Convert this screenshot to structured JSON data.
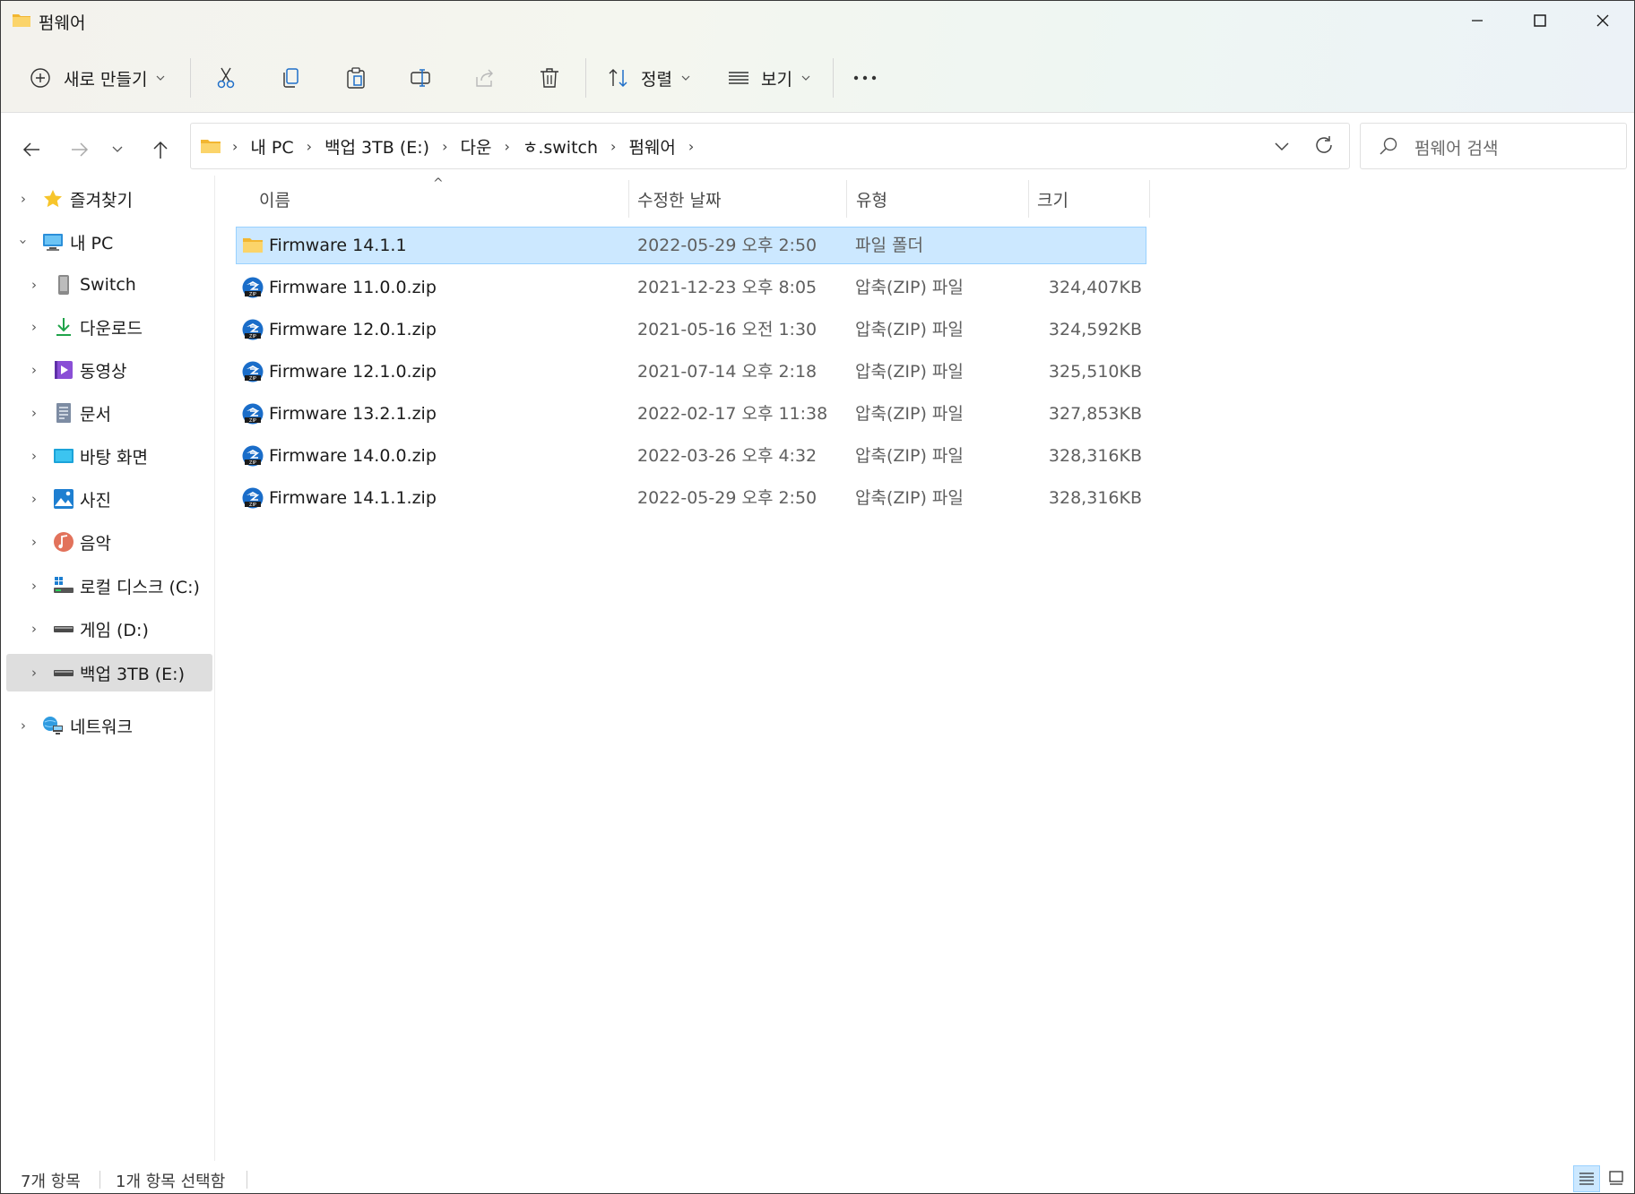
{
  "window": {
    "title": "펌웨어",
    "folder_icon": "folder-icon"
  },
  "toolbar": {
    "new_label": "새로 만들기",
    "sort_label": "정렬",
    "view_label": "보기"
  },
  "address": {
    "crumbs": [
      "내 PC",
      "백업 3TB (E:)",
      "다운",
      "ㅎ.switch",
      "펌웨어"
    ]
  },
  "search": {
    "placeholder": "펌웨어 검색"
  },
  "sidebar": {
    "items": [
      {
        "label": "즐겨찾기",
        "icon": "star-icon"
      },
      {
        "label": "내 PC",
        "icon": "pc-icon"
      },
      {
        "label": "Switch",
        "icon": "device-icon"
      },
      {
        "label": "다운로드",
        "icon": "download-icon"
      },
      {
        "label": "동영상",
        "icon": "video-icon"
      },
      {
        "label": "문서",
        "icon": "document-icon"
      },
      {
        "label": "바탕 화면",
        "icon": "desktop-icon"
      },
      {
        "label": "사진",
        "icon": "pictures-icon"
      },
      {
        "label": "음악",
        "icon": "music-icon"
      },
      {
        "label": "로컬 디스크 (C:)",
        "icon": "drive-c-icon"
      },
      {
        "label": "게임 (D:)",
        "icon": "drive-d-icon"
      },
      {
        "label": "백업 3TB (E:)",
        "icon": "drive-e-icon"
      },
      {
        "label": "네트워크",
        "icon": "network-icon"
      }
    ]
  },
  "columns": {
    "name": "이름",
    "date": "수정한 날짜",
    "type": "유형",
    "size": "크기"
  },
  "files": [
    {
      "name": "Firmware 14.1.1",
      "date": "2022-05-29 오후 2:50",
      "type": "파일 폴더",
      "size": "",
      "kind": "folder"
    },
    {
      "name": "Firmware 11.0.0.zip",
      "date": "2021-12-23 오후 8:05",
      "type": "압축(ZIP) 파일",
      "size": "324,407KB",
      "kind": "zip"
    },
    {
      "name": "Firmware 12.0.1.zip",
      "date": "2021-05-16 오전 1:30",
      "type": "압축(ZIP) 파일",
      "size": "324,592KB",
      "kind": "zip"
    },
    {
      "name": "Firmware 12.1.0.zip",
      "date": "2021-07-14 오후 2:18",
      "type": "압축(ZIP) 파일",
      "size": "325,510KB",
      "kind": "zip"
    },
    {
      "name": "Firmware 13.2.1.zip",
      "date": "2022-02-17 오후 11:38",
      "type": "압축(ZIP) 파일",
      "size": "327,853KB",
      "kind": "zip"
    },
    {
      "name": "Firmware 14.0.0.zip",
      "date": "2022-03-26 오후 4:32",
      "type": "압축(ZIP) 파일",
      "size": "328,316KB",
      "kind": "zip"
    },
    {
      "name": "Firmware 14.1.1.zip",
      "date": "2022-05-29 오후 2:50",
      "type": "압축(ZIP) 파일",
      "size": "328,316KB",
      "kind": "zip"
    }
  ],
  "status": {
    "count": "7개 항목",
    "selected": "1개 항목 선택함"
  },
  "colors": {
    "selection_bg": "#cce8ff",
    "selection_border": "#99d1ff",
    "folder": "#f8c94b",
    "accent": "#0067c0"
  }
}
